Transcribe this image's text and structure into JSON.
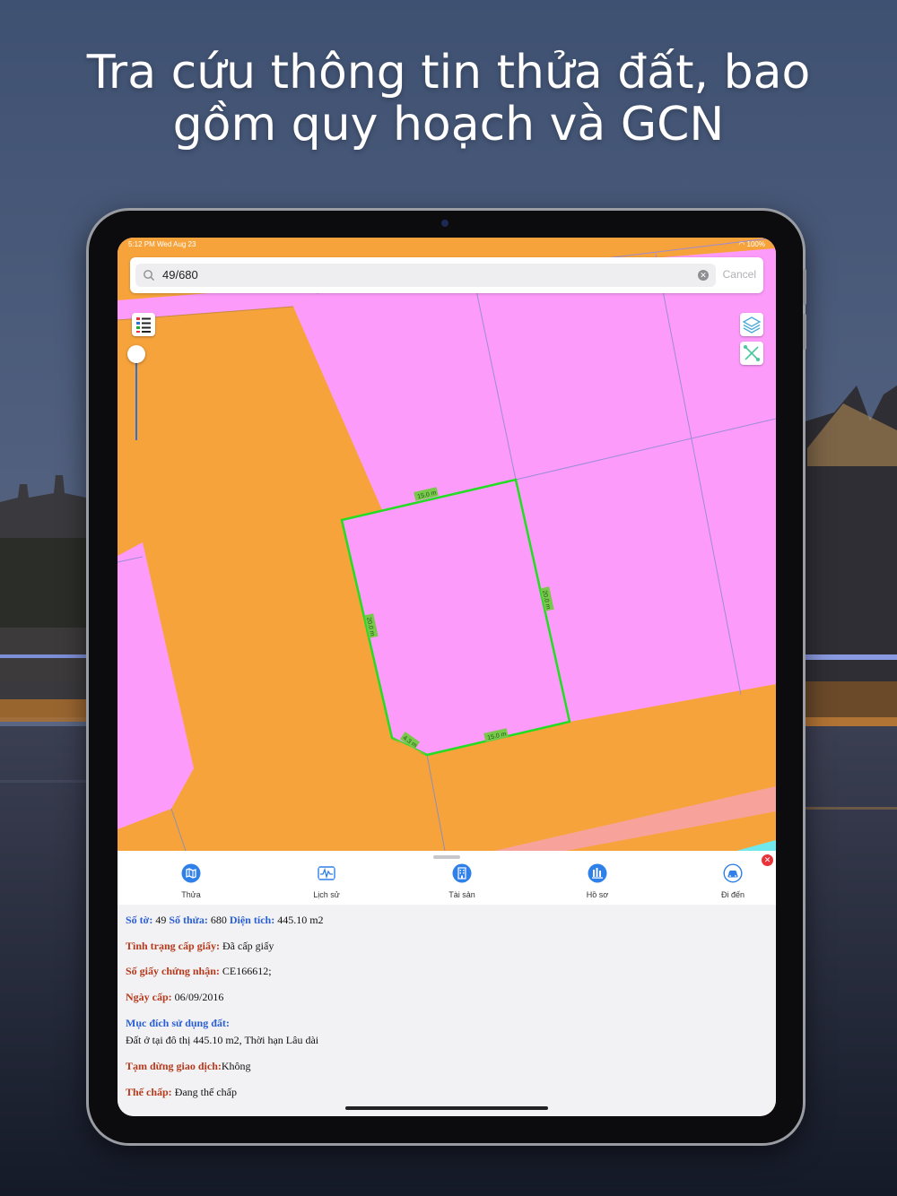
{
  "headline": {
    "line1": "Tra cứu thông tin thửa đất, bao",
    "line2": "gồm quy hoạch và  GCN"
  },
  "status_bar": {
    "time": "5:12 PM  Wed Aug 23",
    "battery": "100%"
  },
  "search": {
    "value": "49/680",
    "cancel_label": "Cancel"
  },
  "map": {
    "edge_labels": [
      "15.0 m",
      "20.0 m",
      "20.0 m",
      "4.3 m",
      "15.0 m"
    ],
    "colors": {
      "road": "#f7a33c",
      "residential": "#fd9bfb",
      "highlight": "#22dd22",
      "salmon": "#f7a39b",
      "cyan": "#6fe9ee"
    }
  },
  "tabs": [
    {
      "label": "Thửa",
      "icon": "map-icon"
    },
    {
      "label": "Lịch sử",
      "icon": "history-chart-icon"
    },
    {
      "label": "Tài sản",
      "icon": "building-icon"
    },
    {
      "label": "Hồ sơ",
      "icon": "records-icon"
    },
    {
      "label": "Đi đến",
      "icon": "car-icon"
    }
  ],
  "info": {
    "so_to_label": "Số tờ:",
    "so_to": "49",
    "so_thua_label": "Số thửa:",
    "so_thua": "680",
    "dien_tich_label": "Diện tích:",
    "dien_tich": "445.10 m2",
    "tinh_trang_label": "Tình trạng cấp giấy:",
    "tinh_trang": "Đã cấp giấy",
    "so_giay_label": "Số giấy chứng nhận:",
    "so_giay": "CE166612;",
    "ngay_cap_label": "Ngày cấp:",
    "ngay_cap": "06/09/2016",
    "muc_dich_label": "Mục đích sử dụng đất:",
    "muc_dich": "Đất ở tại đô thị 445.10 m2, Thời hạn Lâu dài",
    "tam_dung_label": "Tạm dừng giao dịch:",
    "tam_dung": "Không",
    "the_chap_label": "Thế chấp:",
    "the_chap": "Đang thế chấp"
  }
}
